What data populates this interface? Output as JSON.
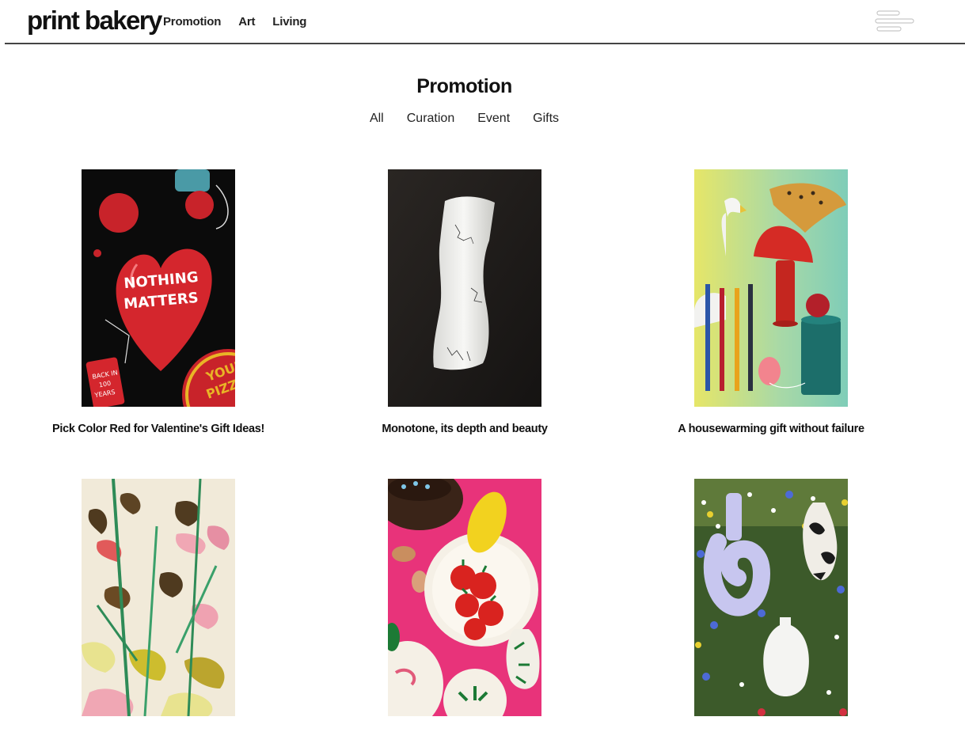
{
  "header": {
    "logo": "print bakery",
    "nav": [
      "Promotion",
      "Art",
      "Living"
    ],
    "menu_icon": "hamburger-menu-icon"
  },
  "section": {
    "title": "Promotion",
    "filters": [
      "All",
      "Curation",
      "Event",
      "Gifts"
    ]
  },
  "cards": [
    {
      "caption": "Pick Color Red for Valentine's Gift Ideas!",
      "image": "red-heart-poster-image",
      "poster_text_1": "NOTHING",
      "poster_text_2": "MATTERS",
      "badge_text": "BACK IN 100 YEARS",
      "circle_text": "YOUR PIZZA"
    },
    {
      "caption": "Monotone, its depth and beauty",
      "image": "white-ceramic-sculpture-image"
    },
    {
      "caption": "A housewarming gift without failure",
      "image": "swan-mushroom-lamp-objects-image"
    },
    {
      "caption": "",
      "image": "floral-painting-image"
    },
    {
      "caption": "",
      "image": "tomato-plate-tableware-image"
    },
    {
      "caption": "",
      "image": "vases-in-wildflower-meadow-image"
    }
  ],
  "colors": {
    "header_line": "#444444",
    "text": "#111111"
  }
}
